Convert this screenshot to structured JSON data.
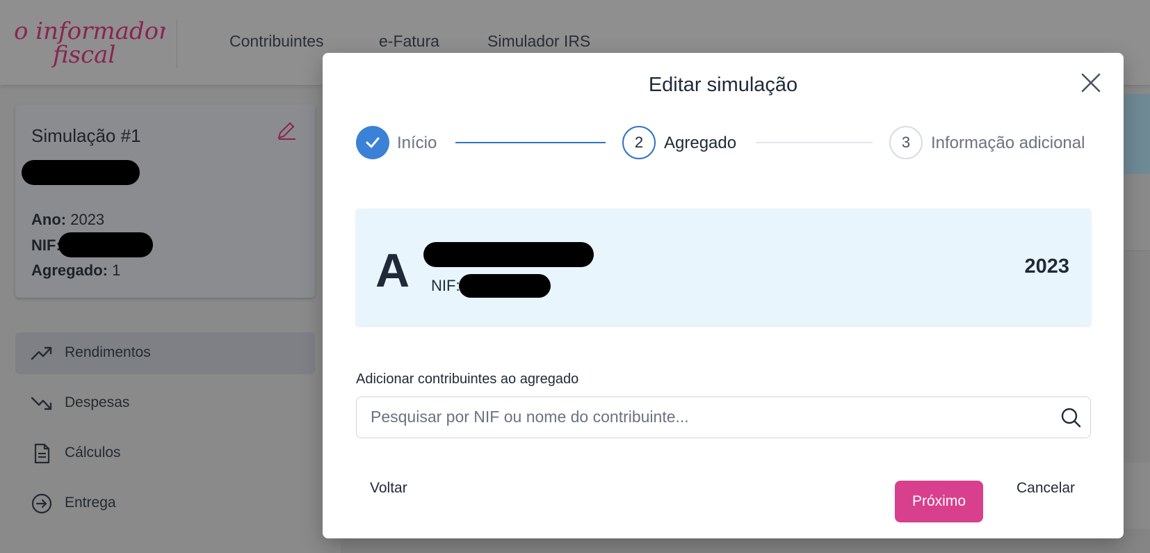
{
  "header": {
    "logo_alt": "o informador fiscal",
    "nav": [
      "Contribuintes",
      "e-Fatura",
      "Simulador IRS"
    ]
  },
  "simulation_card": {
    "title": "Simulação #1",
    "ano_label": "Ano:",
    "ano_value": "2023",
    "nif_label": "NIF:",
    "agregado_label": "Agregado:",
    "agregado_value": "1"
  },
  "sidebar": {
    "items": [
      {
        "label": "Rendimentos",
        "icon": "trending-up-icon",
        "active": true
      },
      {
        "label": "Despesas",
        "icon": "trending-down-icon",
        "active": false
      },
      {
        "label": "Cálculos",
        "icon": "document-icon",
        "active": false
      },
      {
        "label": "Entrega",
        "icon": "arrow-circle-right-icon",
        "active": false
      }
    ]
  },
  "modal": {
    "title": "Editar simulação",
    "steps": [
      {
        "number": "1",
        "label": "Início",
        "state": "done"
      },
      {
        "number": "2",
        "label": "Agregado",
        "state": "current"
      },
      {
        "number": "3",
        "label": "Informação adicional",
        "state": "todo"
      }
    ],
    "profile": {
      "initial": "A",
      "nif_label": "NIF:",
      "year": "2023"
    },
    "add_label": "Adicionar contribuintes ao agregado",
    "search": {
      "placeholder": "Pesquisar por NIF ou nome do contribuinte...",
      "value": ""
    },
    "buttons": {
      "back": "Voltar",
      "next": "Próximo",
      "cancel": "Cancelar"
    }
  },
  "colors": {
    "accent_blue": "#3b82d6",
    "brand_pink": "#d83f8d",
    "profile_bg": "#e8f5fd",
    "overlay": "#8a8a8a"
  }
}
